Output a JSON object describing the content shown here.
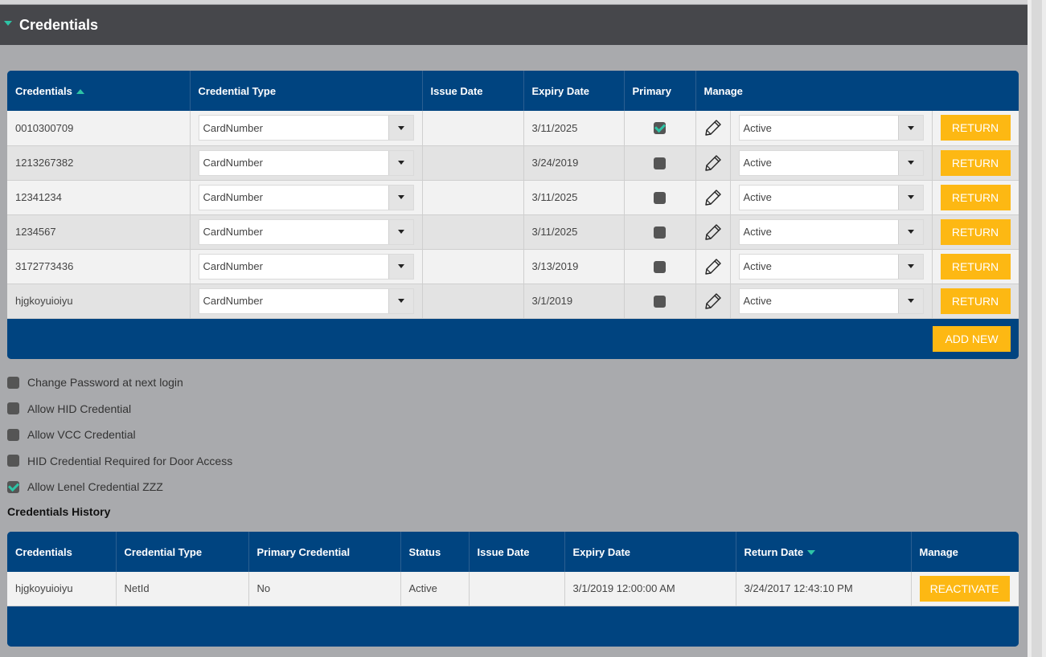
{
  "section": {
    "title": "Credentials"
  },
  "credentials_table": {
    "headers": {
      "credentials": "Credentials",
      "type": "Credential Type",
      "issue": "Issue Date",
      "expiry": "Expiry Date",
      "primary": "Primary",
      "manage": "Manage"
    },
    "rows": [
      {
        "id": "0010300709",
        "type": "CardNumber",
        "issue": "",
        "expiry": "3/11/2025",
        "primary": true,
        "status": "Active",
        "action": "RETURN"
      },
      {
        "id": "1213267382",
        "type": "CardNumber",
        "issue": "",
        "expiry": "3/24/2019",
        "primary": false,
        "status": "Active",
        "action": "RETURN"
      },
      {
        "id": "12341234",
        "type": "CardNumber",
        "issue": "",
        "expiry": "3/11/2025",
        "primary": false,
        "status": "Active",
        "action": "RETURN"
      },
      {
        "id": "1234567",
        "type": "CardNumber",
        "issue": "",
        "expiry": "3/11/2025",
        "primary": false,
        "status": "Active",
        "action": "RETURN"
      },
      {
        "id": "3172773436",
        "type": "CardNumber",
        "issue": "",
        "expiry": "3/13/2019",
        "primary": false,
        "status": "Active",
        "action": "RETURN"
      },
      {
        "id": "hjgkoyuioiyu",
        "type": "CardNumber",
        "issue": "",
        "expiry": "3/1/2019",
        "primary": false,
        "status": "Active",
        "action": "RETURN"
      }
    ],
    "add_new_label": "ADD NEW"
  },
  "options": [
    {
      "label": "Change Password at next login",
      "checked": false
    },
    {
      "label": "Allow HID Credential",
      "checked": false
    },
    {
      "label": "Allow VCC Credential",
      "checked": false
    },
    {
      "label": "HID Credential Required for Door Access",
      "checked": false
    },
    {
      "label": "Allow Lenel Credential ZZZ",
      "checked": true
    }
  ],
  "history": {
    "title": "Credentials History",
    "headers": {
      "credentials": "Credentials",
      "type": "Credential Type",
      "primary": "Primary Credential",
      "status": "Status",
      "issue": "Issue Date",
      "expiry": "Expiry Date",
      "return": "Return Date",
      "manage": "Manage"
    },
    "rows": [
      {
        "id": "hjgkoyuioiyu",
        "type": "NetId",
        "primary": "No",
        "status": "Active",
        "issue": "",
        "expiry": "3/1/2019 12:00:00 AM",
        "return": "3/24/2017 12:43:10 PM",
        "action": "REACTIVATE"
      }
    ]
  },
  "colors": {
    "header_blue": "#004480",
    "accent_teal": "#2ec4a6",
    "button_yellow": "#fdb813",
    "section_bar": "#46474b"
  }
}
